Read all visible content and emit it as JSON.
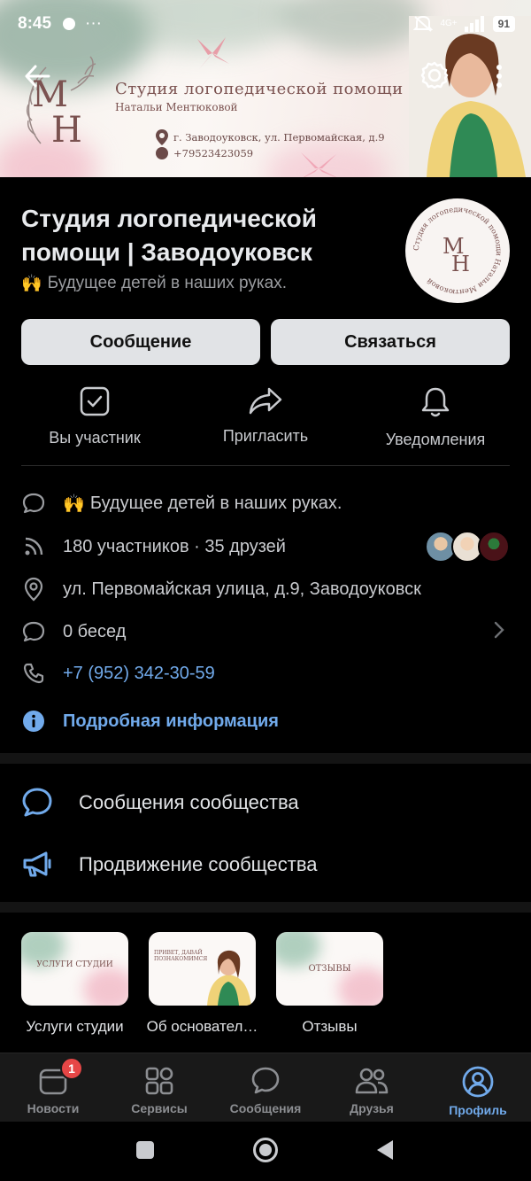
{
  "statusbar": {
    "time": "8:45",
    "more": "···",
    "network": "4G+",
    "battery": "91"
  },
  "cover": {
    "title": "Студия логопедической помощи",
    "subtitle": "Натальи Ментюковой",
    "address": "г. Заводоуковск, ул. Первомайская, д.9",
    "phone": "+79523423059",
    "logo_letters": "MH"
  },
  "header": {
    "title": "Студия логопедической помощи | Заводоуковск",
    "status_emoji": "🙌",
    "status": "Будущее детей в наших руках.",
    "avatar_ring_text": "Студия логопедической помощи Натальи Ментюковой"
  },
  "buttons": {
    "message": "Сообщение",
    "contact": "Связаться"
  },
  "actions": [
    {
      "label": "Вы участник",
      "icon": "checkbox-icon"
    },
    {
      "label": "Пригласить",
      "icon": "share-icon"
    },
    {
      "label": "Уведомления",
      "icon": "bell-icon"
    }
  ],
  "info": {
    "status": "Будущее детей в наших руках.",
    "members": "180 участников · 35 друзей",
    "address": "ул. Первомайская улица, д.9, Заводоуковск",
    "chats": "0 бесед",
    "phone": "+7 (952) 342-30-59",
    "more": "Подробная информация"
  },
  "menu": {
    "messages": "Сообщения сообщества",
    "promotion": "Продвижение сообщества"
  },
  "cards": [
    {
      "label": "Услуги студии",
      "image_text": "УСЛУГИ СТУДИИ"
    },
    {
      "label": "Об основател…",
      "image_text": "ПРИВЕТ, ДАВАЙ ПОЗНАКОМИМСЯ"
    },
    {
      "label": "Отзывы",
      "image_text": "ОТЗЫВЫ"
    }
  ],
  "tabs": [
    {
      "label": "Новости",
      "badge": "1"
    },
    {
      "label": "Сервисы"
    },
    {
      "label": "Сообщения"
    },
    {
      "label": "Друзья"
    },
    {
      "label": "Профиль"
    }
  ],
  "colors": {
    "accent": "#71aaeb",
    "badge": "#e64646",
    "background": "#000000",
    "button": "#e1e3e6"
  }
}
